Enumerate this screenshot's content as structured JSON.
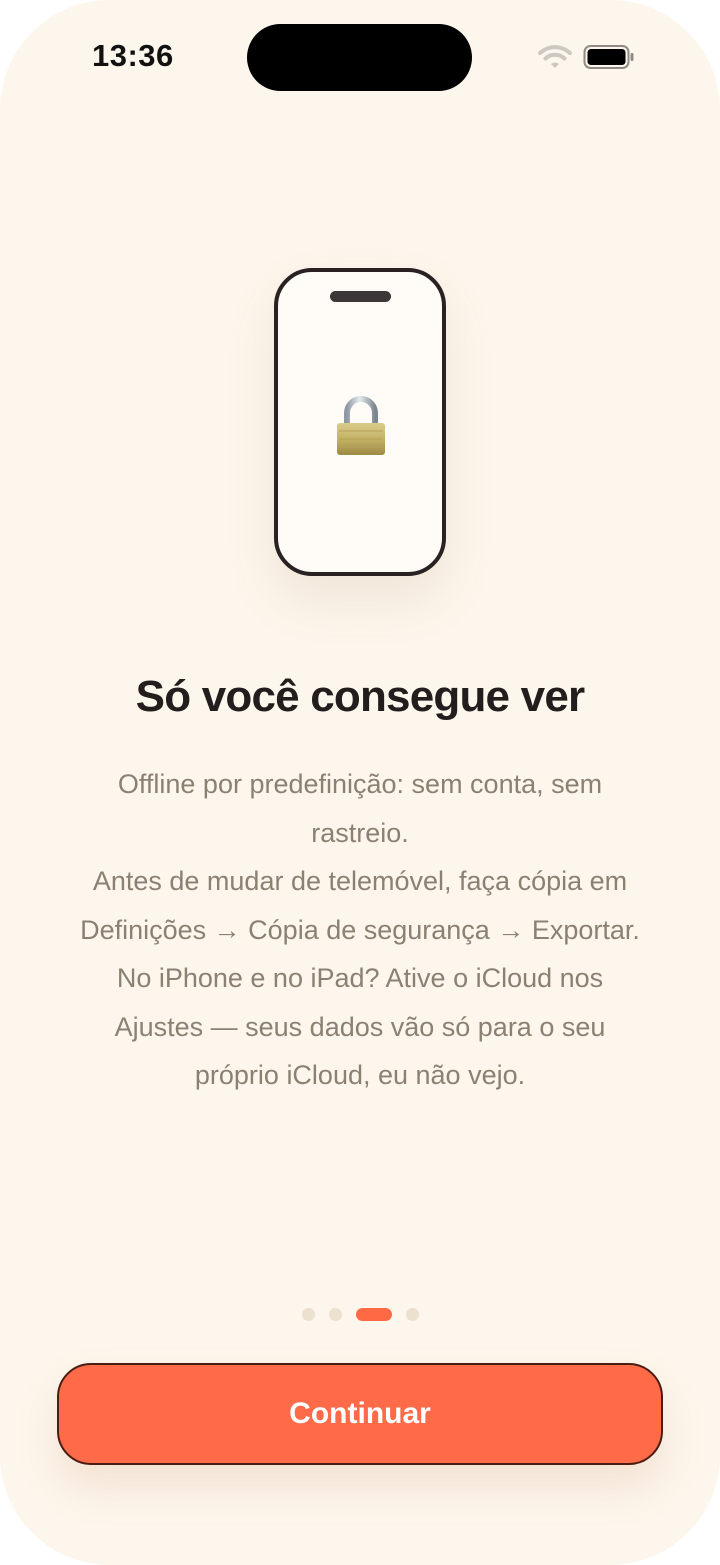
{
  "status_bar": {
    "time": "13:36",
    "wifi_icon": "wifi-icon",
    "battery_icon": "battery-icon"
  },
  "illustration": {
    "device_icon": "phone-outline-icon",
    "lock_icon": "padlock-icon"
  },
  "content": {
    "title": "Só você consegue ver",
    "body_lines": [
      "Offline por predefinição: sem conta, sem",
      "rastreio.",
      "Antes de mudar de telemóvel, faça cópia em",
      "Definições → Cópia de segurança → Exportar.",
      "No iPhone e no iPad? Ative o iCloud nos",
      "Ajustes — seus dados vão só para o seu",
      "próprio iCloud, eu não vejo."
    ]
  },
  "pager": {
    "total_pages": 4,
    "current_page": 3
  },
  "actions": {
    "continue_label": "Continuar"
  },
  "colors": {
    "background": "#fdf6ec",
    "accent": "#ff6a48",
    "title": "#231d1d",
    "body": "#8a8173",
    "dot_inactive": "#ece0cf"
  }
}
